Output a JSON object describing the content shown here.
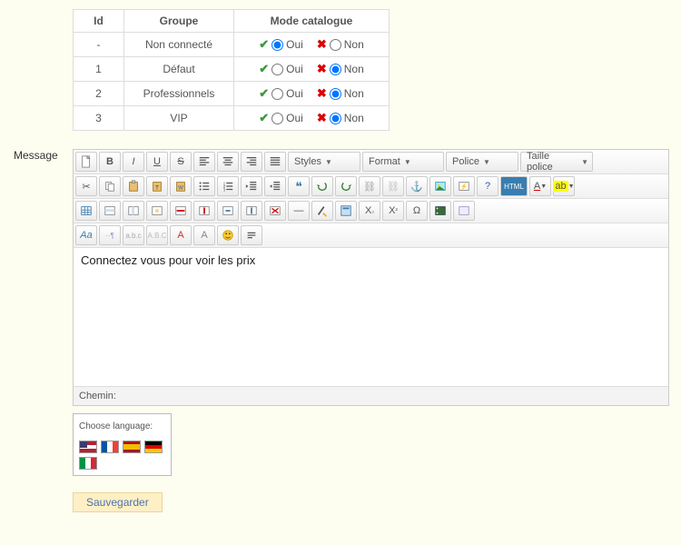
{
  "table": {
    "headers": {
      "id": "Id",
      "group": "Groupe",
      "mode": "Mode catalogue"
    },
    "yes": "Oui",
    "no": "Non",
    "rows": [
      {
        "id": "-",
        "group": "Non connecté",
        "selected": "yes"
      },
      {
        "id": "1",
        "group": "Défaut",
        "selected": "no"
      },
      {
        "id": "2",
        "group": "Professionnels",
        "selected": "no"
      },
      {
        "id": "3",
        "group": "VIP",
        "selected": "no"
      }
    ]
  },
  "message": {
    "label": "Message",
    "body": "Connectez vous pour voir les prix",
    "path_label": "Chemin:",
    "dropdowns": {
      "styles": "Styles",
      "format": "Format",
      "font": "Police",
      "size": "Taille police"
    }
  },
  "lang_box": {
    "title": "Choose language:",
    "flags": [
      "us",
      "fr",
      "es",
      "de",
      "it"
    ]
  },
  "save_label": "Sauvegarder"
}
